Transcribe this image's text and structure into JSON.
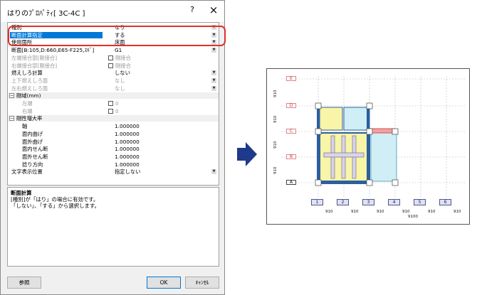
{
  "dialog": {
    "title": "はりのﾌﾟﾛﾊﾟﾃｨ[ 3C-4C ]",
    "help": "?",
    "close": "×"
  },
  "rows": [
    {
      "key": "種別",
      "value": "なり",
      "dd": true,
      "dis": false,
      "chk": false
    },
    {
      "key": "断面計算指定",
      "value": "する",
      "dd": true,
      "sel": true,
      "chk": false
    },
    {
      "key": "使用箇所",
      "value": "床面",
      "dd": true,
      "chk": false
    },
    {
      "key": "断面[B:105,D:660,E65-F225,ｽｷﾞ]",
      "value": "G1",
      "dd": true,
      "chk": false
    },
    {
      "key": "左端接合部[剛接合]",
      "value": "剛接合",
      "dis": true,
      "chk": true
    },
    {
      "key": "右端接合部[剛接合]",
      "value": "剛接合",
      "dis": true,
      "chk": true
    },
    {
      "key": "燃えしろ計算",
      "value": "しない",
      "dd": true,
      "chk": false
    },
    {
      "key": "上下燃えしろ面",
      "value": "なし",
      "dis": true,
      "dd": true,
      "chk": false
    },
    {
      "key": "左右燃えしろ面",
      "value": "なし",
      "dis": true,
      "dd": true,
      "chk": false
    },
    {
      "key": "剛域(mm)",
      "value": "",
      "cat": true,
      "chk": false
    },
    {
      "key": "左端",
      "value": "0",
      "sub": true,
      "chk": true,
      "dis": true
    },
    {
      "key": "右端",
      "value": "0",
      "sub": true,
      "chk": true,
      "dis": true
    },
    {
      "key": "剛性増大率",
      "value": "",
      "cat": true,
      "chk": false
    },
    {
      "key": "軸",
      "value": "1.000000",
      "sub": true,
      "chk": false
    },
    {
      "key": "面内曲げ",
      "value": "1.000000",
      "sub": true,
      "chk": false
    },
    {
      "key": "面外曲げ",
      "value": "1.000000",
      "sub": true,
      "chk": false
    },
    {
      "key": "面内せん断",
      "value": "1.000000",
      "sub": true,
      "chk": false
    },
    {
      "key": "面外せん断",
      "value": "1.000000",
      "sub": true,
      "chk": false
    },
    {
      "key": "捻り方向",
      "value": "1.000000",
      "sub": true,
      "chk": false
    },
    {
      "key": "文字表示位置",
      "value": "指定しない",
      "dd": true,
      "chk": false
    }
  ],
  "description": {
    "title": "断面計算",
    "line1": "[種別]が「はり」の場合に有効です。",
    "line2": "「しない」、「する」から選択します。"
  },
  "buttons": {
    "ref": "参照",
    "ok": "OK",
    "cancel": "ｷｬﾝｾﾙ"
  },
  "plan": {
    "levels": [
      "E",
      "D",
      "C",
      "B",
      "A"
    ],
    "vdims": [
      "910",
      "910",
      "910",
      "910"
    ],
    "columns": [
      "1",
      "2",
      "3",
      "4",
      "5",
      "6"
    ],
    "hdims": [
      "910",
      "910",
      "910",
      "910",
      "910",
      "910"
    ],
    "total": "9100"
  },
  "colors": {
    "accent": "#0078d7",
    "highlight": "#e0302a"
  }
}
